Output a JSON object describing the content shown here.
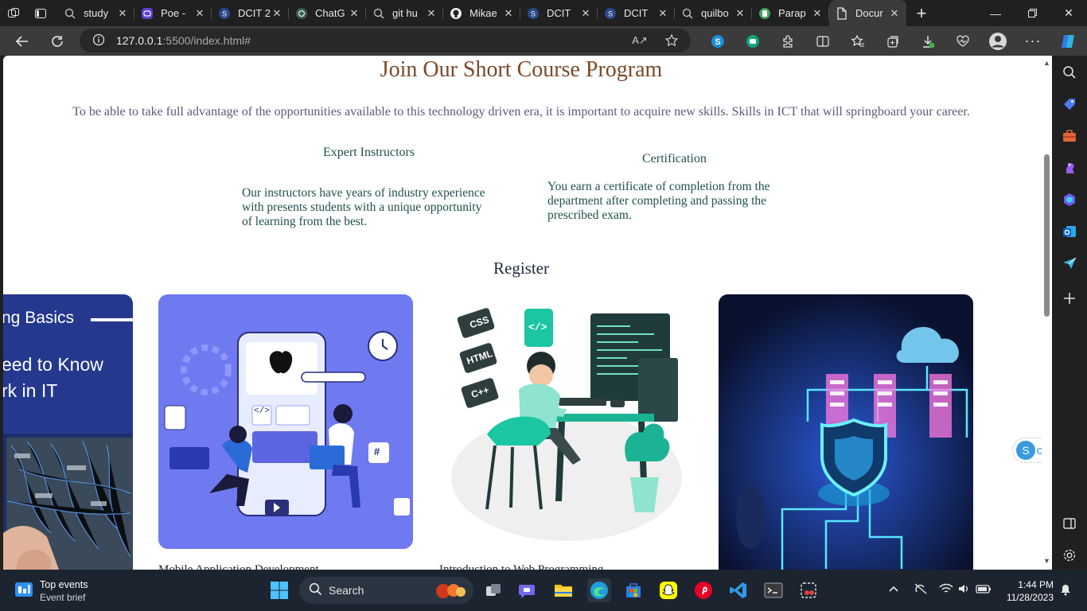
{
  "browser": {
    "tabs": [
      {
        "label": "study",
        "icon": "search-icon"
      },
      {
        "label": "Poe -",
        "icon": "poe-icon"
      },
      {
        "label": "DCIT 2",
        "icon": "site-icon"
      },
      {
        "label": "ChatG",
        "icon": "chatgpt-icon"
      },
      {
        "label": "git hu",
        "icon": "search-icon"
      },
      {
        "label": "Mikae",
        "icon": "github-icon"
      },
      {
        "label": "DCIT",
        "icon": "site-icon"
      },
      {
        "label": "DCIT",
        "icon": "site-icon"
      },
      {
        "label": "quilbo",
        "icon": "search-icon"
      },
      {
        "label": "Parap",
        "icon": "paraphrase-icon"
      },
      {
        "label": "Docur",
        "icon": "document-icon",
        "active": true
      }
    ],
    "url_host": "127.0.0.1",
    "url_path": ":5500/index.html#"
  },
  "page": {
    "title": "Join Our Short Course Program",
    "intro": "To be able to take full advantage of the opportunities available to this technology driven era, it is important to acquire new skills. Skills in ICT that will springboard your career.",
    "features": [
      {
        "title": "Expert Instructors",
        "text_lines": [
          "Our instructors have years of industry experience",
          "with presents students with a unique opportunity",
          "of learning from the best."
        ]
      },
      {
        "title": "Certification",
        "text_lines": [
          "You earn a certificate of completion from the",
          "department after completing and passing the",
          "prescribed exam."
        ]
      }
    ],
    "register_heading": "Register",
    "cards": [
      {
        "overlay_lines": [
          "ng Basics",
          "eed to Know",
          "rk in IT"
        ],
        "caption": ""
      },
      {
        "overlay_lines": [],
        "caption": "Mobile Application Development",
        "image_text": [
          "</>",
          "#"
        ]
      },
      {
        "overlay_lines": [],
        "caption": "Introduction to Web Programming",
        "image_text": [
          "CSS",
          "HTML",
          "C++",
          "</>"
        ]
      },
      {
        "overlay_lines": [],
        "caption": ""
      }
    ],
    "float_button_letter": "S",
    "float_button_peek": "c"
  },
  "taskbar": {
    "widget_title": "Top events",
    "widget_sub": "Event brief",
    "search_label": "Search",
    "time": "1:44 PM",
    "date": "11/28/2023"
  }
}
